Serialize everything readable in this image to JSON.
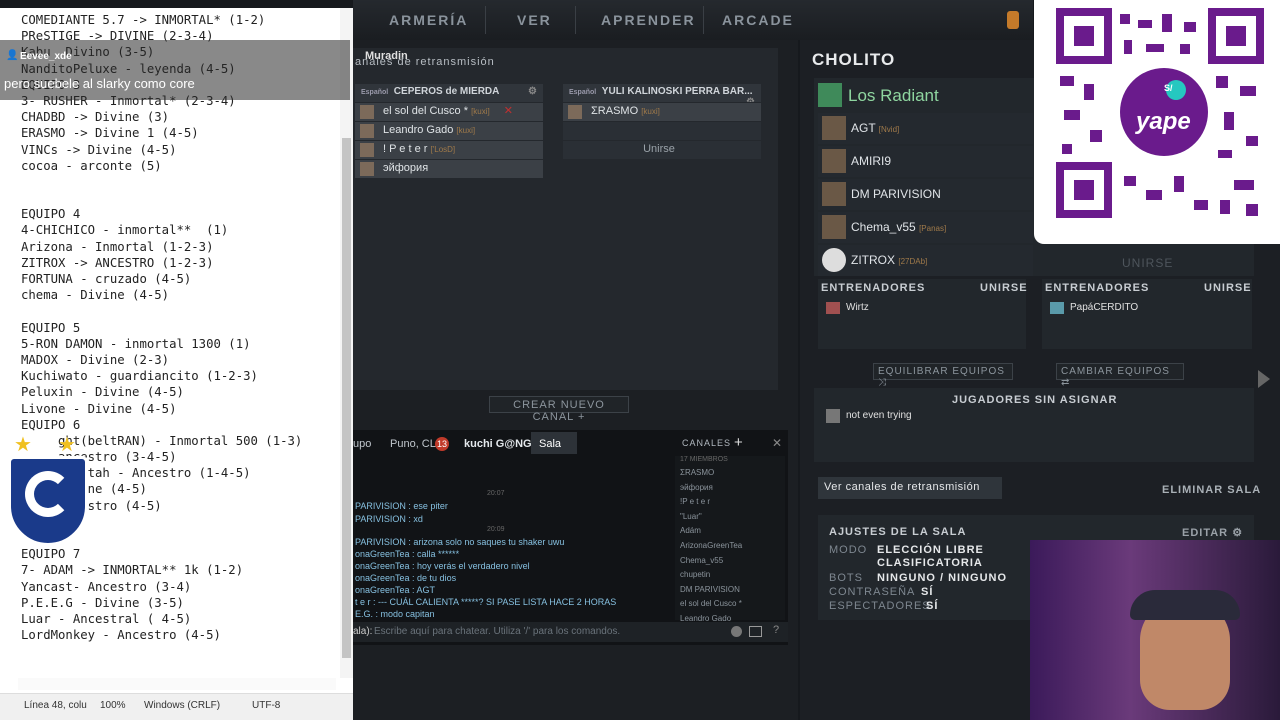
{
  "nav": {
    "items": [
      "ARMERÍA",
      "VER",
      "APRENDER",
      "ARCADE"
    ]
  },
  "chat_overlay": {
    "user": "Eevee_xde",
    "message": "pero suebele al slarky como core"
  },
  "notepad": {
    "lines": [
      "COMEDIANTE 5.7 -> INMORTAL* (1-2)",
      "PReSTIGE -> DIVINE (2-3-4)",
      "Kabu  Divino (3-5)",
      "NanditoPeluxe - leyenda (4-5)",
      "EQUIPO 3",
      "3- RUSHER - Inmortal* (2-3-4)",
      "CHADBD -> Divine (3)",
      "ERASMO -> Divine 1 (4-5)",
      "VINCs -> Divine (4-5)",
      "cocoa - arconte (5)",
      "",
      "",
      "EQUIPO 4",
      "4-CHICHICO - inmortal**  (1)",
      "Arizona - Inmortal (1-2-3)",
      "ZITROX -> ANCESTRO (1-2-3)",
      "FORTUNA - cruzado (4-5)",
      "chema - Divine (4-5)",
      "",
      "EQUIPO 5",
      "5-RON DAMON - inmortal 1300 (1)",
      "MADOX - Divine (2-3)",
      "Kuchiwato - guardiancito (1-2-3)",
      "Peluxin - Divine (4-5)",
      "Livone - Divine (4-5)",
      "EQUIPO 6",
      "     ght(beltRAN) - Inmortal 500 (1-3)",
      "     ancestro (3-4-5)",
      "     angstah - Ancestro (1-4-5)",
      "     Divine (4-5)",
      "     ancestro (4-5)",
      "",
      "",
      "EQUIPO 7",
      "7- ADAM -> INMORTAL** 1k (1-2)",
      "Yancast- Ancestro (3-4)",
      "P.E.E.G - Divine (3-5)",
      "Luar - Ancestral ( 4-5)",
      "LordMonkey - Ancestro (4-5)"
    ],
    "status": {
      "position": "Línea 48, colu",
      "zoom": "100%",
      "eol": "Windows (CRLF)",
      "encoding": "UTF-8"
    }
  },
  "lobby": {
    "muradin": "Muradin",
    "panel_title": "anales de retransmisión",
    "channel1": {
      "lang": "Español",
      "name": "CEPEROS de MIERDA",
      "members": [
        {
          "name": "el sol del Cusco *",
          "tag": "[kuxi]"
        },
        {
          "name": "Leandro Gado",
          "tag": "[kuxi]"
        },
        {
          "name": "! P e t e r",
          "tag": "['LosD]"
        },
        {
          "name": "эйфория",
          "tag": ""
        }
      ]
    },
    "channel2": {
      "lang": "Español",
      "name": "YULI KALINOSKI PERRA BAR...",
      "members": [
        {
          "name": "ΣRASMO",
          "tag": "[kuxi]"
        }
      ],
      "join": "Unirse"
    },
    "create_channel": "CREAR NUEVO CANAL"
  },
  "chat": {
    "tabs": [
      "upo",
      "Puno, CL",
      "kuchi G@NG",
      "Sala"
    ],
    "badge": "13",
    "channels_label": "CANALES",
    "member_count": "17 MIEMBROS",
    "members": [
      "ΣRASMO",
      "эйфория",
      "!P e t e r",
      "\"Luar\"",
      "Adám",
      "ArizonaGreenTea",
      "Chema_v55",
      "chupetin",
      "DM PARIVISION",
      "el sol del Cusco *",
      "Leandro Gado"
    ],
    "times": [
      "20:07",
      "20:09"
    ],
    "lines": [
      "PARIVISION : ese piter",
      "PARIVISION : xd",
      "PARIVISION : arizona solo no saques tu shaker uwu",
      "onaGreenTea : calla ******",
      "onaGreenTea : hoy verás el verdadero nivel",
      "onaGreenTea : de tu dios",
      "onaGreenTea : AGT",
      "t e r : --- CUÁL CALIENTA *****? SI PASE LISTA HACE 2 HORAS",
      "E.G. : modo capitan"
    ],
    "input_prefix": "ala):",
    "input_placeholder": "Escribe aquí para chatear. Utiliza '/' para los comandos."
  },
  "right": {
    "title": "CHOLITO",
    "team_name": "Los Radiant",
    "players": [
      {
        "name": "AGT",
        "tag": "[Nvid]"
      },
      {
        "name": "AMIRI9",
        "tag": ""
      },
      {
        "name": "DM PARIVISION",
        "tag": ""
      },
      {
        "name": "Chema_v55",
        "tag": "[Panas]"
      },
      {
        "name": "ZITROX",
        "tag": "[27DAb]"
      }
    ],
    "join": "UNIRSE",
    "coaches_label": "ENTRENADORES",
    "coaches_join": "UNIRSE",
    "coach1": "Wirtz",
    "coach2": "PapáCERDITO",
    "balance": "EQUILIBRAR EQUIPOS",
    "swap": "CAMBIAR EQUIPOS",
    "unassigned_label": "JUGADORES SIN ASIGNAR",
    "unassigned_player": "not even trying",
    "view_channels": "Ver canales de retransmisión",
    "delete_room": "ELIMINAR SALA",
    "settings_label": "AJUSTES DE LA SALA",
    "edit": "EDITAR",
    "settings": [
      {
        "k": "MODO",
        "v": "ELECCIÓN LIBRE"
      },
      {
        "k": "",
        "v": "CLASIFICATORIA"
      },
      {
        "k": "BOTS",
        "v": "NINGUNO / NINGUNO"
      },
      {
        "k": "CONTRASEÑA",
        "v": "SÍ"
      },
      {
        "k": "ESPECTADORES",
        "v": "SÍ"
      }
    ]
  },
  "qr": {
    "brand": "yape",
    "symbol": "S/"
  },
  "colors": {
    "accent_green": "#8fd6a0",
    "chat_blue": "#86c0e0",
    "yape_purple": "#6a1b8c"
  }
}
